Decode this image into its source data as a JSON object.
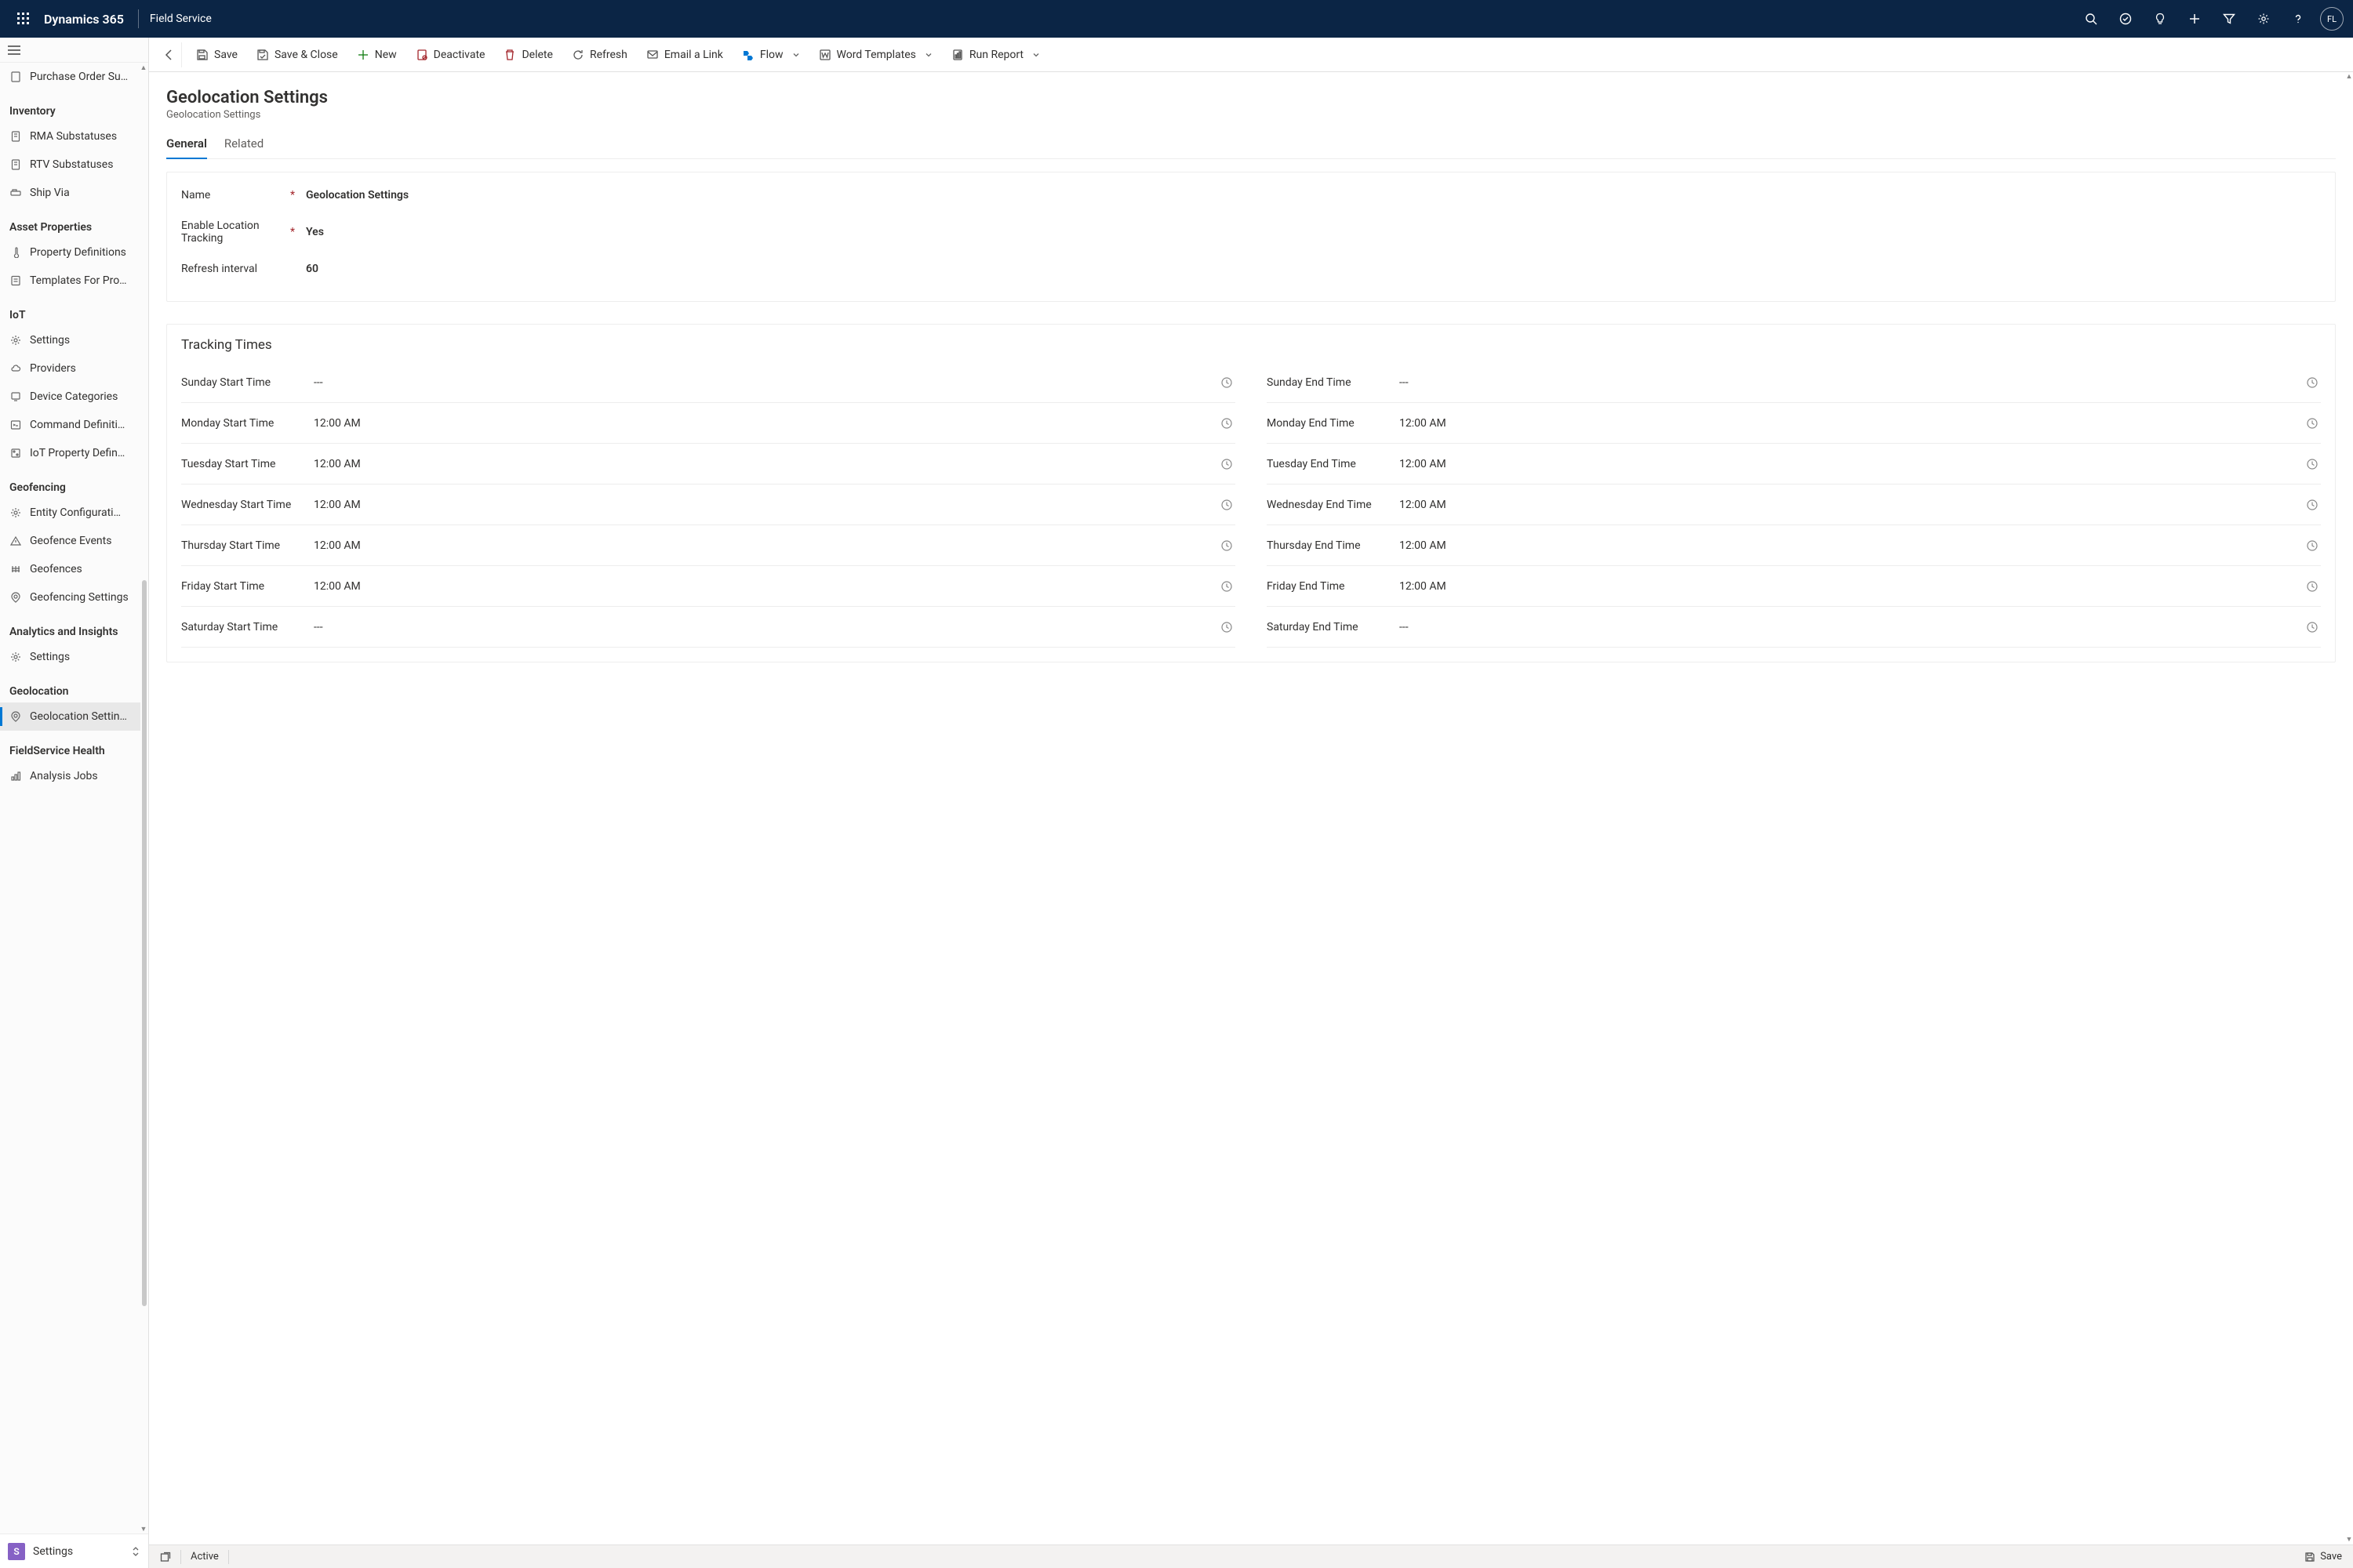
{
  "top": {
    "brand": "Dynamics 365",
    "module": "Field Service",
    "avatar_initials": "FL"
  },
  "toolbar": {
    "save": "Save",
    "save_close": "Save & Close",
    "new": "New",
    "deactivate": "Deactivate",
    "delete": "Delete",
    "refresh": "Refresh",
    "email_link": "Email a Link",
    "flow": "Flow",
    "word_templates": "Word Templates",
    "run_report": "Run Report"
  },
  "sidebar": {
    "truncated_top_item": "Purchase Order Su…",
    "groups": [
      {
        "title": "Inventory",
        "items": [
          {
            "icon": "doc",
            "label": "RMA Substatuses"
          },
          {
            "icon": "doc",
            "label": "RTV Substatuses"
          },
          {
            "icon": "ship",
            "label": "Ship Via"
          }
        ]
      },
      {
        "title": "Asset Properties",
        "items": [
          {
            "icon": "thermo",
            "label": "Property Definitions"
          },
          {
            "icon": "template",
            "label": "Templates For Pro…"
          }
        ]
      },
      {
        "title": "IoT",
        "items": [
          {
            "icon": "gear",
            "label": "Settings"
          },
          {
            "icon": "cloud",
            "label": "Providers"
          },
          {
            "icon": "device",
            "label": "Device Categories"
          },
          {
            "icon": "cmd",
            "label": "Command Definiti…"
          },
          {
            "icon": "prop",
            "label": "IoT Property Defin…"
          }
        ]
      },
      {
        "title": "Geofencing",
        "items": [
          {
            "icon": "gear",
            "label": "Entity Configurati…"
          },
          {
            "icon": "alert",
            "label": "Geofence Events"
          },
          {
            "icon": "fence",
            "label": "Geofences"
          },
          {
            "icon": "geo",
            "label": "Geofencing Settings"
          }
        ]
      },
      {
        "title": "Analytics and Insights",
        "items": [
          {
            "icon": "gear",
            "label": "Settings"
          }
        ]
      },
      {
        "title": "Geolocation",
        "items": [
          {
            "icon": "geo",
            "label": "Geolocation Settin…",
            "selected": true
          }
        ]
      },
      {
        "title": "FieldService Health",
        "items": [
          {
            "icon": "analysis",
            "label": "Analysis Jobs"
          }
        ]
      }
    ],
    "footer": {
      "badge": "S",
      "label": "Settings"
    }
  },
  "page": {
    "title": "Geolocation Settings",
    "subtitle": "Geolocation Settings",
    "tabs": [
      {
        "label": "General",
        "active": true
      },
      {
        "label": "Related",
        "active": false
      }
    ],
    "fields": {
      "name_label": "Name",
      "name_value": "Geolocation Settings",
      "enable_label": "Enable Location Tracking",
      "enable_value": "Yes",
      "refresh_label": "Refresh interval",
      "refresh_value": "60"
    },
    "tracking": {
      "heading": "Tracking Times",
      "start": [
        {
          "label": "Sunday Start Time",
          "value": "---"
        },
        {
          "label": "Monday Start Time",
          "value": "12:00 AM"
        },
        {
          "label": "Tuesday Start Time",
          "value": "12:00 AM"
        },
        {
          "label": "Wednesday Start Time",
          "value": "12:00 AM"
        },
        {
          "label": "Thursday Start Time",
          "value": "12:00 AM"
        },
        {
          "label": "Friday Start Time",
          "value": "12:00 AM"
        },
        {
          "label": "Saturday Start Time",
          "value": "---"
        }
      ],
      "end": [
        {
          "label": "Sunday End Time",
          "value": "---"
        },
        {
          "label": "Monday End Time",
          "value": "12:00 AM"
        },
        {
          "label": "Tuesday End Time",
          "value": "12:00 AM"
        },
        {
          "label": "Wednesday End Time",
          "value": "12:00 AM"
        },
        {
          "label": "Thursday End Time",
          "value": "12:00 AM"
        },
        {
          "label": "Friday End Time",
          "value": "12:00 AM"
        },
        {
          "label": "Saturday End Time",
          "value": "---"
        }
      ]
    }
  },
  "statusbar": {
    "status": "Active",
    "save": "Save"
  }
}
